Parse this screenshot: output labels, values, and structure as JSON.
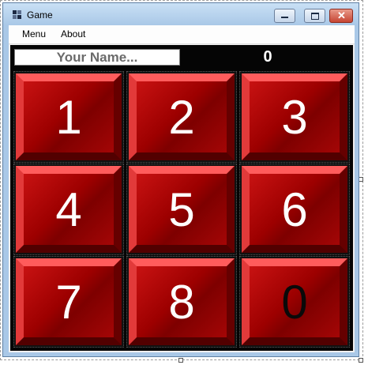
{
  "window": {
    "title": "Game"
  },
  "menu": {
    "items": [
      {
        "label": "Menu"
      },
      {
        "label": "About"
      }
    ]
  },
  "player": {
    "name_placeholder": "Your Name...",
    "name_value": ""
  },
  "score": {
    "value": "0"
  },
  "board": {
    "tiles": [
      {
        "label": "1"
      },
      {
        "label": "2"
      },
      {
        "label": "3"
      },
      {
        "label": "4"
      },
      {
        "label": "5"
      },
      {
        "label": "6"
      },
      {
        "label": "7"
      },
      {
        "label": "8"
      },
      {
        "label": "0"
      }
    ],
    "empty_tile_label": "0"
  },
  "colors": {
    "tile_red": "#b00000",
    "tile_text": "#ffffff",
    "empty_text": "#000000",
    "board_bg": "#050505"
  }
}
